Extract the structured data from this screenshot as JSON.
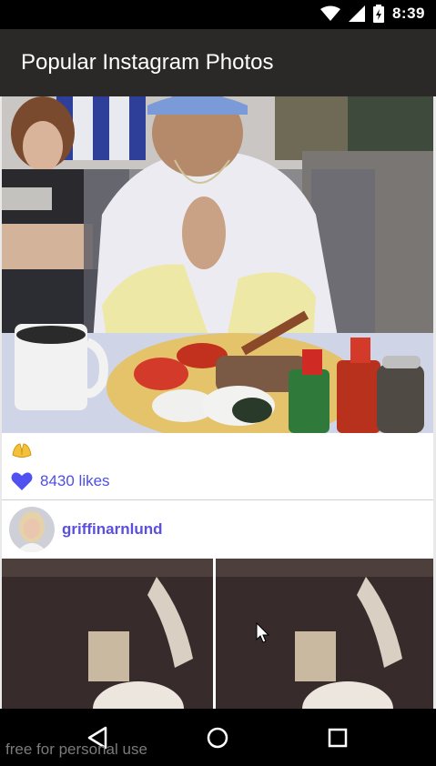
{
  "status_bar": {
    "time": "8:39",
    "icons": [
      "wifi-icon",
      "cell-signal-icon",
      "battery-charging-icon"
    ]
  },
  "app_bar": {
    "title": "Popular Instagram Photos"
  },
  "feed": {
    "posts": [
      {
        "caption_icon": "hands-emoji-icon",
        "likes_count": "8430",
        "likes_label": "8430 likes",
        "username": "griffinarnlund",
        "colors": {
          "accent": "#5a4fe0",
          "heart": "#5151ef"
        }
      }
    ]
  },
  "navigation": {
    "buttons": [
      "back-icon",
      "home-icon",
      "recents-icon"
    ]
  },
  "watermark": "free for personal use"
}
